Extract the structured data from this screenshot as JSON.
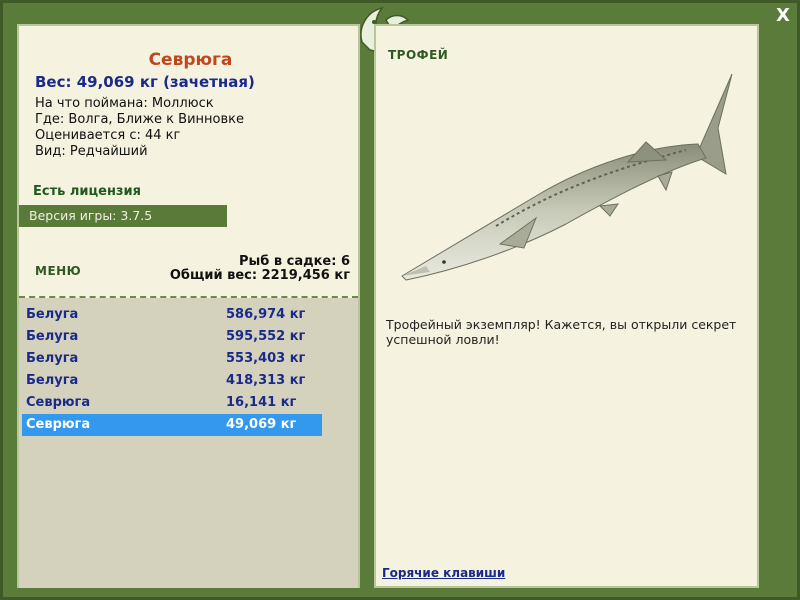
{
  "details": {
    "fish_name": "Севрюга",
    "weight_line": "Вес: 49,069 кг (зачетная)",
    "caught_on": "На что поймана: Моллюск",
    "where": "Где: Волга, Ближе к Винновке",
    "rated_from": "Оценивается с: 44 кг",
    "kind": "Вид: Редчайший",
    "license": "Есть лицензия",
    "version": "Версия игры: 3.7.5"
  },
  "menu": {
    "label": "МЕНЮ"
  },
  "cage": {
    "count": "Рыб в садке: 6",
    "total_weight": "Общий вес: 2219,456 кг"
  },
  "catch_list": [
    {
      "name": "Белуга",
      "weight": "586,974 кг"
    },
    {
      "name": "Белуга",
      "weight": "595,552 кг"
    },
    {
      "name": "Белуга",
      "weight": "553,403 кг"
    },
    {
      "name": "Белуга",
      "weight": "418,313 кг"
    },
    {
      "name": "Севрюга",
      "weight": "16,141 кг"
    },
    {
      "name": "Севрюга",
      "weight": "49,069 кг"
    }
  ],
  "selected_index": 5,
  "trophy": {
    "label": "ТРОФЕЙ",
    "text": "Трофейный экземпляр! Кажется, вы открыли секрет успешной ловли!"
  },
  "footer": {
    "hotkeys": "Горячие клавиши"
  },
  "window": {
    "close_label": "X"
  },
  "colors": {
    "frame": "#5b7b3b",
    "panel": "#f5f2e0",
    "selected_row": "#3399ee",
    "fish_name": "#c0461e",
    "list_text": "#1a2a8a"
  }
}
